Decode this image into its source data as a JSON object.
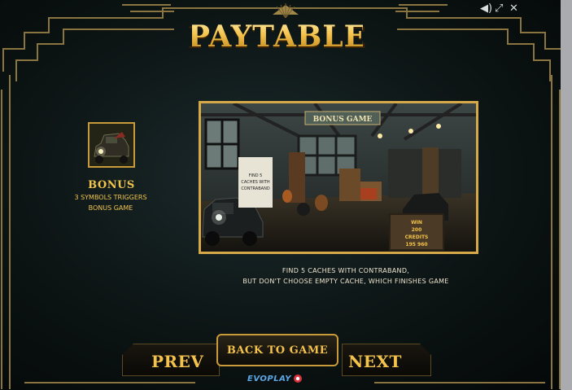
{
  "title": "PAYTABLE",
  "window_controls": [
    {
      "name": "sound-icon",
      "glyph": "◀)"
    },
    {
      "name": "fullscreen-icon",
      "glyph": "⤢"
    },
    {
      "name": "close-icon",
      "glyph": "✕"
    }
  ],
  "symbol": {
    "name": "BONUS",
    "description_lines": [
      "3 SYMBOLS TRIGGERS",
      "BONUS GAME"
    ]
  },
  "scene": {
    "sign": "BONUS GAME",
    "note_lines": [
      "FIND 5",
      "CACHES WITH",
      "CONTRABAND"
    ],
    "win_box_lines": [
      "WIN",
      "200",
      "CREDITS",
      "195 960"
    ]
  },
  "description_lines": [
    "FIND 5 CACHES WITH CONTRABAND,",
    "BUT DON'T CHOOSE EMPTY CACHE, WHICH FINISHES GAME"
  ],
  "nav": {
    "prev": "PREV",
    "back": "BACK TO GAME",
    "next": "NEXT"
  },
  "brand": "EVOPLAY",
  "colors": {
    "gold": "#f3c24c",
    "gold_dark": "#b57a14",
    "frame": "#8a7540",
    "background": "#0c1414"
  }
}
